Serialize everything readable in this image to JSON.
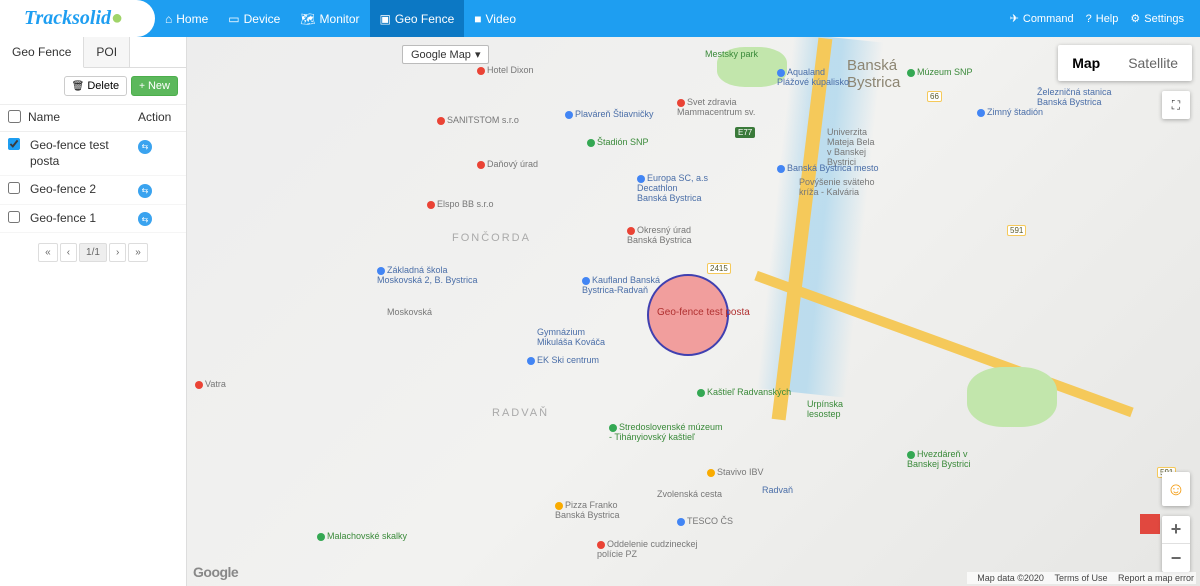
{
  "brand": "Tracksolid",
  "nav": {
    "home": "Home",
    "device": "Device",
    "monitor": "Monitor",
    "geofence": "Geo Fence",
    "video": "Video",
    "command": "Command",
    "help": "Help",
    "settings": "Settings"
  },
  "sidebar": {
    "tabs": {
      "geofence": "Geo Fence",
      "poi": "POI"
    },
    "toolbar": {
      "delete": "Delete",
      "new": "New"
    },
    "cols": {
      "name": "Name",
      "action": "Action"
    },
    "rows": [
      {
        "name": "Geo-fence test posta",
        "checked": true
      },
      {
        "name": "Geo-fence 2",
        "checked": false
      },
      {
        "name": "Geo-fence 1",
        "checked": false
      }
    ],
    "pager": {
      "first": "«",
      "prev": "‹",
      "current": "1/1",
      "next": "›",
      "last": "»"
    }
  },
  "map": {
    "type_dropdown": "Google Map",
    "tabs": {
      "map": "Map",
      "satellite": "Satellite"
    },
    "geo_label": "Geo-fence test posta",
    "logo": "Google",
    "credits": {
      "data": "Map data ©2020",
      "terms": "Terms of Use",
      "report": "Report a map error"
    },
    "zoom": {
      "in": "+",
      "out": "−"
    },
    "pois": {
      "city": "Banská\nBystrica",
      "univ": "Univerzita\nMateja Bela\nv Banskej\nBystrici",
      "bbmesto": "Banská Bystrica mesto",
      "mestsky": "Mestsky park",
      "aqualand": "Aqualand\nPlážové kúpalisko",
      "hoteldixon": "Hotel Dixon",
      "plavaren": "Plaváreň Štiavničky",
      "stadion": "Štadión SNP",
      "svet": "Svet zdravia\nMammacentrum sv.",
      "europa": "Europa SC, a.s\nDecathlon\nBanská Bystrica",
      "povysenie": "Povýšenie sväteho\nkríža - Kalvária",
      "muzeum": "Múzeum SNP",
      "zeleznicna": "Železničná stanica\nBanská Bystrica",
      "zimny": "Zimný štadión",
      "sanitstom": "SANITSTOM s.r.o",
      "elspo": "Elspo BB s.r.o",
      "danovy": "Daňový úrad",
      "foncorda": "FONČORDA",
      "zakladna": "Základná škola\nMoskovská 2, B. Bystrica",
      "moskovska": "Moskovská",
      "okresny": "Okresný úrad\nBanská Bystrica",
      "kaufland": "Kaufland Banská\nBystrica-Radvaň",
      "gymnazium": "Gymnázium\nMikuláša Kováča",
      "ekski": "EK Ski centrum",
      "kastiel": "Kaštieľ Radvanských",
      "urpinska": "Urpínska\nlesostep",
      "vatra": "Vatra",
      "radvan": "RADVAŇ",
      "stredoslov": "Stredoslovenské múzeum\n- Tihányiovský kaštieľ",
      "hvezdaren": "Hvezdáreň v\nBanskej Bystrici",
      "stavivo": "Stavivo IBV",
      "radvanExit": "Radvaň",
      "pizza": "Pizza Franko\nBanská Bystrica",
      "malachov": "Malachovské skalky",
      "oddelenie": "Oddelenie cudzineckej\npolície PZ",
      "tesco": "TESCO ČS",
      "zvolenska": "Zvolenská cesta",
      "shield66": "66",
      "shield591a": "591",
      "shield591b": "591",
      "shieldE77": "E77",
      "shield2415": "2415"
    }
  }
}
